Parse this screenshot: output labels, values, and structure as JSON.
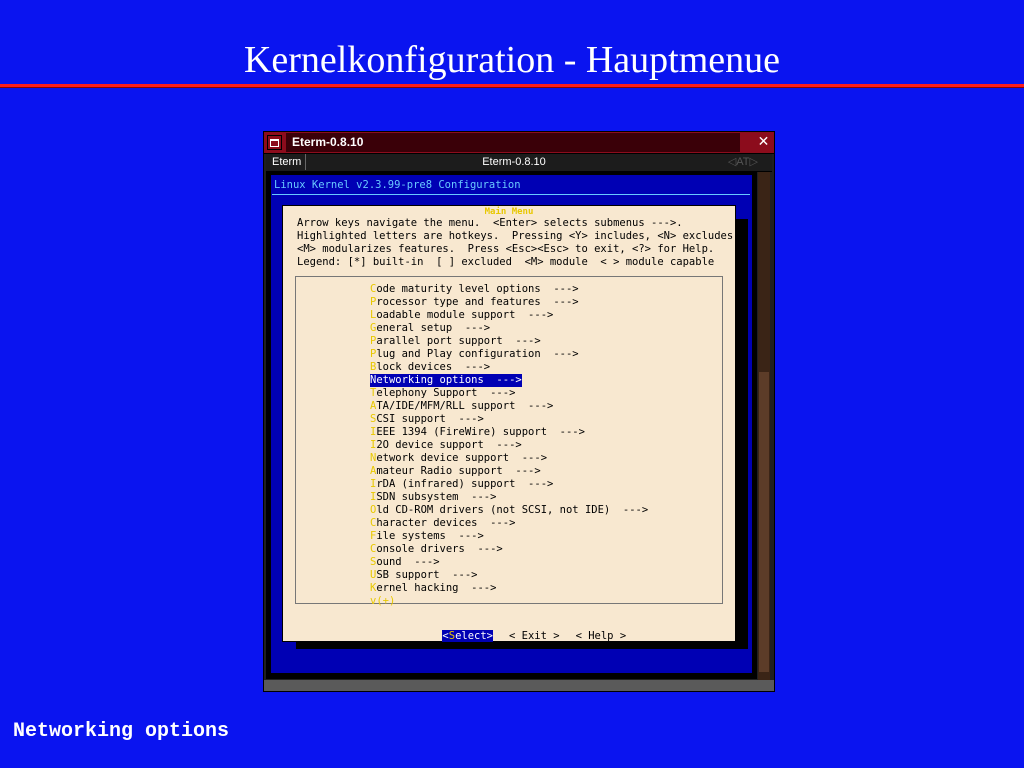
{
  "slide": {
    "title": "Kernelkonfiguration - Hauptmenue",
    "caption": "Networking options"
  },
  "window": {
    "title": "Eterm-0.8.10",
    "close_glyph": "✕",
    "menubar": {
      "left_label": "Eterm",
      "center_label": "Eterm-0.8.10",
      "right_label": "◁AT▷"
    }
  },
  "terminal": {
    "header": "Linux Kernel v2.3.99-pre8 Configuration",
    "dialog": {
      "title": "Main Menu",
      "help_lines": [
        "Arrow keys navigate the menu.  <Enter> selects submenus --->.",
        "Highlighted letters are hotkeys.  Pressing <Y> includes, <N> excludes,",
        "<M> modularizes features.  Press <Esc><Esc> to exit, <?> for Help.",
        "Legend: [*] built-in  [ ] excluded  <M> module  < > module capable"
      ],
      "menu_items": [
        {
          "hotkey": "C",
          "rest": "ode maturity level options  --->"
        },
        {
          "hotkey": "P",
          "rest": "rocessor type and features  --->"
        },
        {
          "hotkey": "L",
          "rest": "oadable module support  --->"
        },
        {
          "hotkey": "G",
          "rest": "eneral setup  --->"
        },
        {
          "hotkey": "P",
          "rest": "arallel port support  --->"
        },
        {
          "hotkey": "P",
          "rest": "lug and Play configuration  --->"
        },
        {
          "hotkey": "B",
          "rest": "lock devices  --->"
        },
        {
          "hotkey": "N",
          "rest": "etworking options  --->"
        },
        {
          "hotkey": "T",
          "rest": "elephony Support  --->"
        },
        {
          "hotkey": "A",
          "rest": "TA/IDE/MFM/RLL support  --->"
        },
        {
          "hotkey": "S",
          "rest": "CSI support  --->"
        },
        {
          "hotkey": "I",
          "rest": "EEE 1394 (FireWire) support  --->"
        },
        {
          "hotkey": "I",
          "rest": "2O device support  --->"
        },
        {
          "hotkey": "N",
          "rest": "etwork device support  --->"
        },
        {
          "hotkey": "A",
          "rest": "mateur Radio support  --->"
        },
        {
          "hotkey": "I",
          "rest": "rDA (infrared) support  --->"
        },
        {
          "hotkey": "I",
          "rest": "SDN subsystem  --->"
        },
        {
          "hotkey": "O",
          "rest": "ld CD-ROM drivers (not SCSI, not IDE)  --->"
        },
        {
          "hotkey": "C",
          "rest": "haracter devices  --->"
        },
        {
          "hotkey": "F",
          "rest": "ile systems  --->"
        },
        {
          "hotkey": "C",
          "rest": "onsole drivers  --->"
        },
        {
          "hotkey": "S",
          "rest": "ound  --->"
        },
        {
          "hotkey": "U",
          "rest": "SB support  --->"
        },
        {
          "hotkey": "K",
          "rest": "ernel hacking  --->"
        }
      ],
      "selected_index": 7,
      "more_indicator": "v(+)",
      "buttons": {
        "select": {
          "open": "<",
          "hotkey": "S",
          "rest": "elect",
          "close": ">"
        },
        "exit": "< Exit >",
        "help": "< Help >"
      }
    }
  },
  "colors": {
    "slide_bg": "#0a14f0",
    "rule": "#ff1c1c",
    "titlebar": "#8c0c1c",
    "dialog_bg": "#f8e8d0",
    "hotkey": "#e8c800",
    "selection_bg": "#0000b4"
  }
}
